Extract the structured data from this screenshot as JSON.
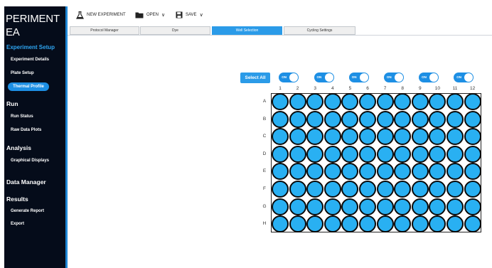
{
  "app": {
    "title_line1": "PERIMENT",
    "title_line2": "EA"
  },
  "sidebar": {
    "experiment_setup": "Experiment Setup",
    "experiment_details": "Experiment Details",
    "plate_setup": "Plate Setup",
    "thermal_profile": "Thermal Profile",
    "run": "Run",
    "run_status": "Run Status",
    "raw_data_plots": "Raw Data Plots",
    "analysis": "Analysis",
    "graphical_displays": "Graphical Displays",
    "data_manager": "Data Manager",
    "results": "Results",
    "generate_report": "Generate Report",
    "export": "Export"
  },
  "toolbar": {
    "new_experiment": "NEW EXPERIMENT",
    "open": "OPEN",
    "save": "SAVE",
    "chevron": "∨"
  },
  "tabs": [
    "Protocol Manager",
    "Dye",
    "Well Selection",
    "Cycling Settings"
  ],
  "active_tab": "Well Selection",
  "plate": {
    "select_all": "Select All",
    "toggle_label": "ON",
    "columns": [
      "1",
      "2",
      "3",
      "4",
      "5",
      "6",
      "7",
      "8",
      "9",
      "10",
      "11",
      "12"
    ],
    "rows": [
      "A",
      "B",
      "C",
      "D",
      "E",
      "F",
      "G",
      "H"
    ],
    "well_color": "#29b0f2",
    "all_wells_selected": true
  },
  "colors": {
    "accent": "#2b9be8",
    "sidebar_bg": "#050c1a",
    "sidebar_active_text": "#2ea5f2"
  }
}
